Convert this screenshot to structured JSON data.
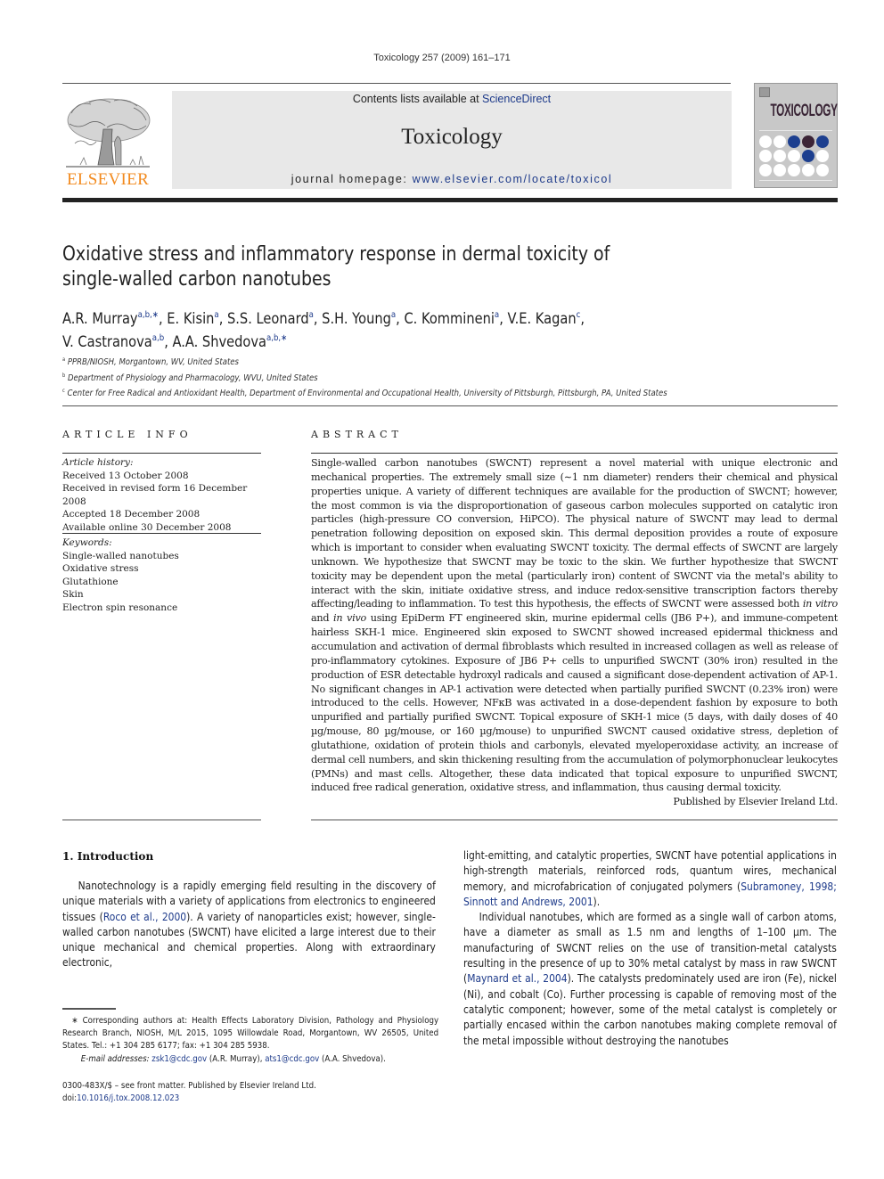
{
  "running_head": "Toxicology 257 (2009) 161–171",
  "masthead": {
    "publisher_logo_text": "ELSEVIER",
    "contents_prefix": "Contents lists available at ",
    "contents_link": "ScienceDirect",
    "journal_title": "Toxicology",
    "homepage_prefix": "journal homepage: ",
    "homepage_link": "www.elsevier.com/locate/toxicol",
    "cover_title": "TOXICOLOGY",
    "cover_dots": [
      "#ffffff",
      "#ffffff",
      "#1d3f8f",
      "#3c2436",
      "#1d3f8f",
      "#ffffff",
      "#ffffff",
      "#ffffff",
      "#1d3f8f",
      "#ffffff",
      "#ffffff",
      "#ffffff",
      "#ffffff",
      "#ffffff",
      "#ffffff"
    ]
  },
  "article": {
    "title_line1": "Oxidative stress and inflammatory response in dermal toxicity of",
    "title_line2": "single-walled carbon nanotubes",
    "authors": [
      {
        "name": "A.R. Murray",
        "sup": "a,b,∗",
        "sep": ", "
      },
      {
        "name": "E. Kisin",
        "sup": "a",
        "sep": ", "
      },
      {
        "name": "S.S. Leonard",
        "sup": "a",
        "sep": ", "
      },
      {
        "name": "S.H. Young",
        "sup": "a",
        "sep": ", "
      },
      {
        "name": "C. Kommineni",
        "sup": "a",
        "sep": ", "
      },
      {
        "name": "V.E. Kagan",
        "sup": "c",
        "sep": ","
      },
      {
        "name": "V. Castranova",
        "sup": "a,b",
        "sep": ", "
      },
      {
        "name": "A.A. Shvedova",
        "sup": "a,b,∗",
        "sep": ""
      }
    ],
    "affiliations": [
      {
        "key": "a",
        "text": "PPRB/NIOSH, Morgantown, WV, United States"
      },
      {
        "key": "b",
        "text": "Department of Physiology and Pharmacology, WVU, United States"
      },
      {
        "key": "c",
        "text": "Center for Free Radical and Antioxidant Health, Department of Environmental and Occupational Health, University of Pittsburgh, Pittsburgh, PA, United States"
      }
    ]
  },
  "article_info": {
    "heading": "ARTICLE INFO",
    "history_label": "Article history:",
    "history": [
      "Received 13 October 2008",
      "Received in revised form 16 December 2008",
      "Accepted 18 December 2008",
      "Available online 30 December 2008"
    ],
    "keywords_label": "Keywords:",
    "keywords": [
      "Single-walled nanotubes",
      "Oxidative stress",
      "Glutathione",
      "Skin",
      "Electron spin resonance"
    ]
  },
  "abstract": {
    "heading": "ABSTRACT",
    "p1": "Single-walled carbon nanotubes (SWCNT) represent a novel material with unique electronic and mechanical properties. The extremely small size (∼1 nm diameter) renders their chemical and physical properties unique. A variety of different techniques are available for the production of SWCNT; however, the most common is via the disproportionation of gaseous carbon molecules supported on catalytic iron particles (high-pressure CO conversion, HiPCO). The physical nature of SWCNT may lead to dermal penetration following deposition on exposed skin. This dermal deposition provides a route of exposure which is important to consider when evaluating SWCNT toxicity. The dermal effects of SWCNT are largely unknown. We hypothesize that SWCNT may be toxic to the skin. We further hypothesize that SWCNT toxicity may be dependent upon the metal (particularly iron) content of SWCNT via the metal's ability to interact with the skin, initiate oxidative stress, and induce redox-sensitive transcription factors thereby affecting/leading to inflammation. To test this hypothesis, the effects of SWCNT were assessed both ",
    "in_vitro": "in vitro",
    "and": " and ",
    "in_vivo": "in vivo",
    "p2": " using EpiDerm FT engineered skin, murine epidermal cells (JB6 P+), and immune-competent hairless SKH-1 mice. Engineered skin exposed to SWCNT showed increased epidermal thickness and accumulation and activation of dermal fibroblasts which resulted in increased collagen as well as release of pro-inflammatory cytokines. Exposure of JB6 P+ cells to unpurified SWCNT (30% iron) resulted in the production of ESR detectable hydroxyl radicals and caused a significant dose-dependent activation of AP-1. No significant changes in AP-1 activation were detected when partially purified SWCNT (0.23% iron) were introduced to the cells. However, NFκB was activated in a dose-dependent fashion by exposure to both unpurified and partially purified SWCNT. Topical exposure of SKH-1 mice (5 days, with daily doses of 40 µg/mouse, 80 µg/mouse, or 160 µg/mouse) to unpurified SWCNT caused oxidative stress, depletion of glutathione, oxidation of protein thiols and carbonyls, elevated myeloperoxidase activity, an increase of dermal cell numbers, and skin thickening resulting from the accumulation of polymorphonuclear leukocytes (PMNs) and mast cells. Altogether, these data indicated that topical exposure to unpurified SWCNT, induced free radical generation, oxidative stress, and inflammation, thus causing dermal toxicity.",
    "published_by": "Published by Elsevier Ireland Ltd."
  },
  "introduction": {
    "heading": "1.  Introduction",
    "left_p1_a": "Nanotechnology is a rapidly emerging field resulting in the discovery of unique materials with a variety of applications from electronics to engineered tissues (",
    "left_cite1": "Roco et al., 2000",
    "left_p1_b": "). A variety of nanoparticles exist; however, single-walled carbon nanotubes (SWCNT) have elicited a large interest due to their unique mechanical and chemical properties. Along with extraordinary electronic,",
    "right_p1_a": "light-emitting, and catalytic properties, SWCNT have potential applications in high-strength materials, reinforced rods, quantum wires, mechanical memory, and microfabrication of conjugated polymers (",
    "right_cite1": "Subramoney, 1998; Sinnott and Andrews, 2001",
    "right_p1_b": ").",
    "right_p2_a": "Individual nanotubes, which are formed as a single wall of carbon atoms, have a diameter as small as 1.5 nm and lengths of 1–100 µm. The manufacturing of SWCNT relies on the use of transition-metal catalysts resulting in the presence of up to 30% metal catalyst by mass in raw SWCNT (",
    "right_cite2": "Maynard et al., 2004",
    "right_p2_b": "). The catalysts predominately used are iron (Fe), nickel (Ni), and cobalt (Co). Further processing is capable of removing most of the catalytic component; however, some of the metal catalyst is completely or partially encased within the carbon nanotubes making complete removal of the metal impossible without destroying the nanotubes"
  },
  "footnotes": {
    "corresponding_mark": "∗",
    "corresponding": " Corresponding authors at: Health Effects Laboratory Division, Pathology and Physiology Research Branch, NIOSH, M/L 2015, 1095 Willowdale Road, Morgantown, WV 26505, United States. Tel.: +1 304 285 6177; fax: +1 304 285 5938.",
    "email_label": "E-mail addresses: ",
    "email1": "zsk1@cdc.gov",
    "email1_owner": " (A.R. Murray), ",
    "email2": "ats1@cdc.gov",
    "email2_owner": " (A.A. Shvedova).",
    "issn": "0300-483X/$ – see front matter. Published by Elsevier Ireland Ltd.",
    "doi_label": "doi:",
    "doi": "10.1016/j.tox.2008.12.023"
  }
}
